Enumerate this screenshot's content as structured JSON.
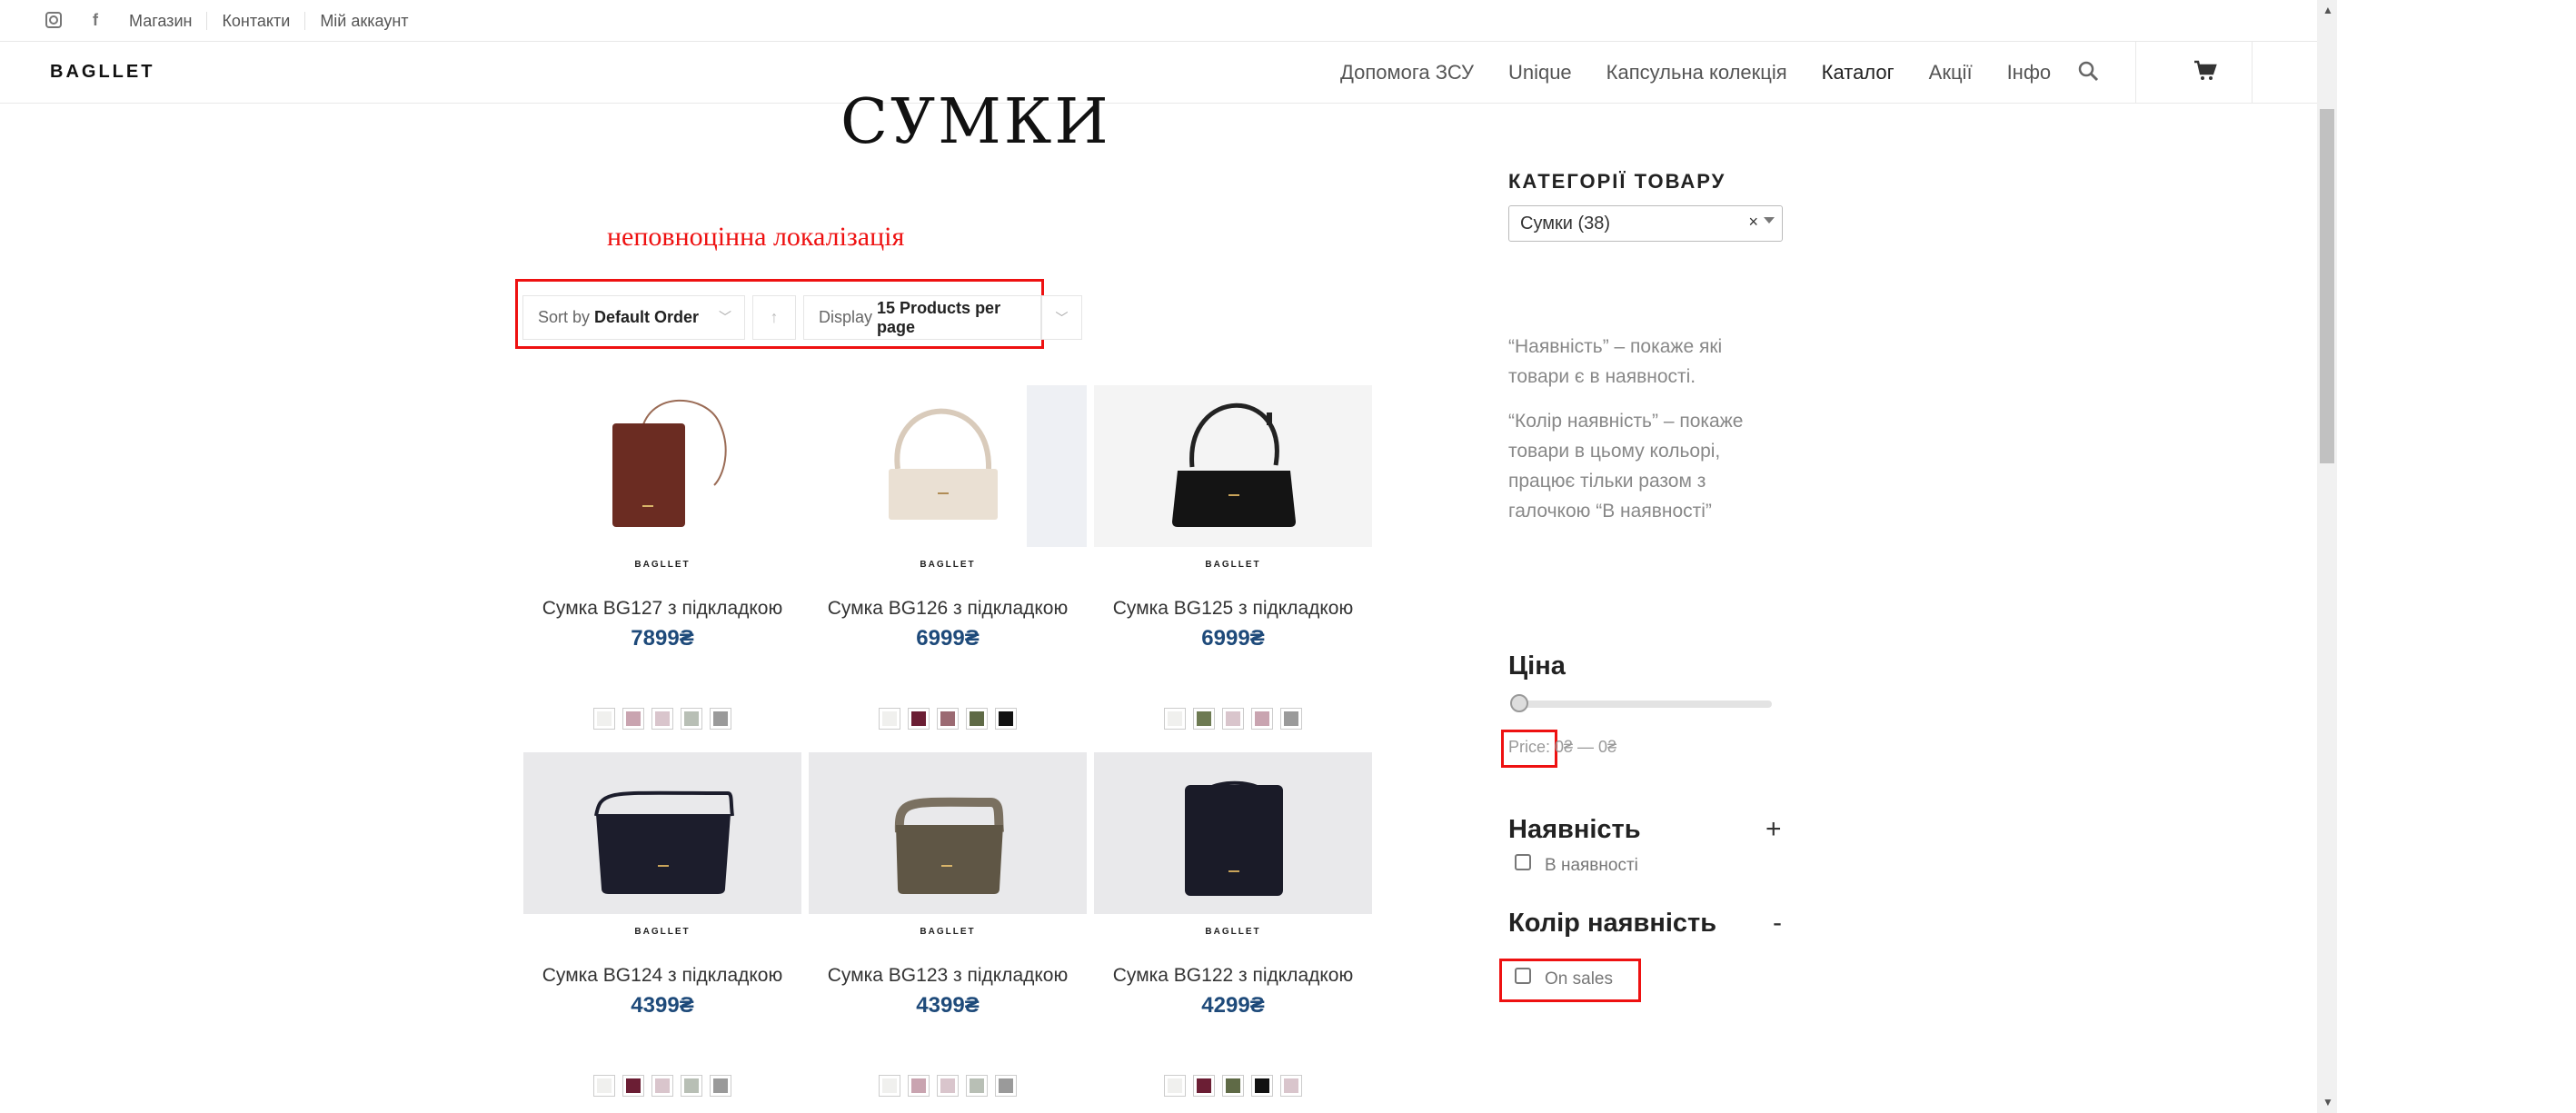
{
  "topbar": {
    "social": [
      "instagram-icon",
      "facebook-icon"
    ],
    "links": [
      "Магазин",
      "Контакти",
      "Мій аккаунт"
    ]
  },
  "header": {
    "logo": "BAGLLET",
    "nav": [
      "Допомога ЗСУ",
      "Unique",
      "Капсульна колекція",
      "Каталог",
      "Акції",
      "Інфо"
    ],
    "active": "Каталог"
  },
  "main": {
    "title": "СУМКИ",
    "annotation": "неповноцінна локалізація",
    "sort_prefix": "Sort by",
    "sort_value": "Default Order",
    "display_prefix": "Display",
    "display_value": "15 Products per page",
    "brand_caption": "BAGLLET",
    "products": [
      {
        "name": "Сумка BG127 з підкладкою",
        "price": "7899₴",
        "swatches": [
          "#f0f0ee",
          "#c9a4b0",
          "#d9c5cc",
          "#b8bfb5",
          "#9a9a9a"
        ],
        "bag_color": "#6b2c22"
      },
      {
        "name": "Сумка BG126 з підкладкою",
        "price": "6999₴",
        "swatches": [
          "#f0f0ee",
          "#6b1e34",
          "#9b6a72",
          "#5f6a46",
          "#111111"
        ],
        "bag_color": "#eae0d3"
      },
      {
        "name": "Сумка BG125 з підкладкою",
        "price": "6999₴",
        "swatches": [
          "#f0f0ee",
          "#6d7a52",
          "#d9c5cc",
          "#c9a4b0",
          "#9a9a9a"
        ],
        "bag_color": "#141414"
      },
      {
        "name": "Сумка BG124 з підкладкою",
        "price": "4399₴",
        "swatches": [
          "#f0f0ee",
          "#6b1e34",
          "#d9c5cc",
          "#b8bfb5",
          "#9a9a9a"
        ],
        "bag_color": "#1c1d2c"
      },
      {
        "name": "Сумка BG123 з підкладкою",
        "price": "4399₴",
        "swatches": [
          "#f0f0ee",
          "#c9a4b0",
          "#d9c5cc",
          "#b8bfb5",
          "#9a9a9a"
        ],
        "bag_color": "#5f5645"
      },
      {
        "name": "Сумка BG122 з підкладкою",
        "price": "4299₴",
        "swatches": [
          "#f0f0ee",
          "#6b1e34",
          "#5f6a46",
          "#111111",
          "#d9c5cc"
        ],
        "bag_color": "#1a1b28"
      }
    ]
  },
  "sidebar": {
    "categories_heading": "КАТЕГОРІЇ ТОВАРУ",
    "category_selected": "Сумки  (38)",
    "info_1": "“Наявність” – покаже які товари є в наявності.",
    "info_2": "“Колір наявність” – покаже товари в цьому кольорі, працює тільки разом з галочкою “В наявності”",
    "price_heading": "Ціна",
    "price_label_prefix": "Price:",
    "price_range": "0₴ — 0₴",
    "availability_heading": "Наявність",
    "availability_toggle": "+",
    "availability_option": "В наявності",
    "color_heading": "Колір наявність",
    "color_toggle": "-",
    "color_option": "On sales"
  },
  "colors": {
    "annotation_red": "#ee1111",
    "price_blue": "#1e4a7a"
  }
}
